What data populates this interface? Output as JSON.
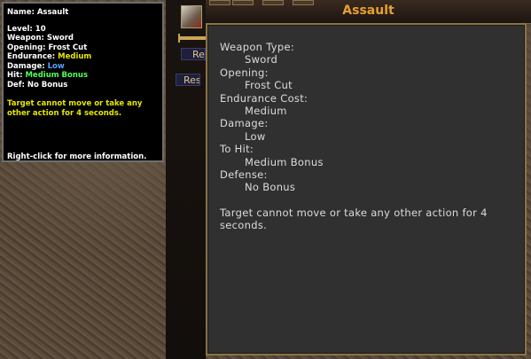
{
  "tooltip": {
    "name_label": "Name:",
    "name": "Assault",
    "level_label": "Level:",
    "level": "10",
    "weapon_label": "Weapon:",
    "weapon": "Sword",
    "opening_label": "Opening:",
    "opening": "Frost Cut",
    "endurance_label": "Endurance:",
    "endurance": "Medium",
    "damage_label": "Damage:",
    "damage": "Low",
    "hit_label": "Hit:",
    "hit": "Medium Bonus",
    "def_label": "Def:",
    "def": "No Bonus",
    "description": "Target cannot move or take any other action for 4 seconds.",
    "hint": "Right-click for more information."
  },
  "side_buttons": {
    "btn1": "Re",
    "btn2": "Rese"
  },
  "window": {
    "title": "Assault",
    "weapon_type_label": "Weapon Type:",
    "weapon_type": "Sword",
    "opening_label": "Opening:",
    "opening": "Frost Cut",
    "endurance_label": "Endurance Cost:",
    "endurance": "Medium",
    "damage_label": "Damage:",
    "damage": "Low",
    "to_hit_label": "To Hit:",
    "to_hit": "Medium Bonus",
    "defense_label": "Defense:",
    "defense": "No Bonus",
    "description": "Target cannot move or take any other action for 4 seconds."
  },
  "colors": {
    "title": "#e8a030",
    "medium": "#e8e800",
    "low": "#5aa0ff",
    "hit": "#54ff54",
    "frame": "#8c7445"
  },
  "icons": {
    "ability": "sword-slash-icon"
  }
}
